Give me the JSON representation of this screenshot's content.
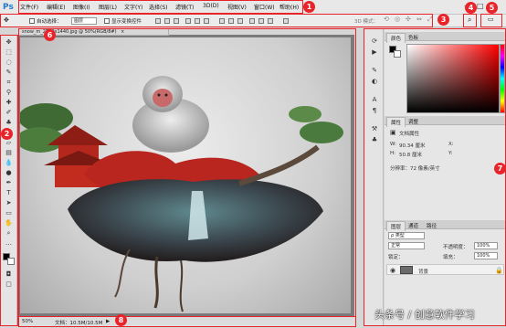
{
  "app": {
    "logo": "Ps"
  },
  "menubar": {
    "items": [
      "文件(F)",
      "编辑(E)",
      "图像(I)",
      "图层(L)",
      "文字(Y)",
      "选择(S)",
      "滤镜(T)",
      "3D(D)",
      "视图(V)",
      "窗口(W)",
      "帮助(H)"
    ],
    "window_controls": [
      "–",
      "□",
      "×"
    ]
  },
  "options_bar": {
    "auto_select_label": "自动选择：",
    "auto_select_value": "图层",
    "show_transform_label": "显示变换控件",
    "mode_3d_label": "3D 模式："
  },
  "document": {
    "tab_title": "snow_m_2560x1440.jpg @ 50%(RGB/8#)",
    "close_glyph": "×"
  },
  "status_bar": {
    "zoom": "50%",
    "doc_info": "文档：10.5M/10.5M",
    "arrow": "▶"
  },
  "panels": {
    "color_tabs": [
      "颜色",
      "色板"
    ],
    "properties_tabs": [
      "属性",
      "调整"
    ],
    "properties_title": "文档属性",
    "prop_w_label": "W:",
    "prop_w_value": "90.34 厘米",
    "prop_h_label": "H:",
    "prop_h_value": "50.8 厘米",
    "prop_x_label": "X:",
    "prop_y_label": "Y:",
    "prop_resolution": "分辨率：72 像素/英寸",
    "layers_tabs": [
      "图层",
      "通道",
      "路径"
    ],
    "layer_filter": "ρ 类型",
    "blend_mode": "正常",
    "opacity_label": "不透明度：",
    "opacity_value": "100%",
    "lock_label": "锁定：",
    "fill_label": "填充：",
    "fill_value": "100%",
    "layer_name": "背景"
  },
  "annotations": [
    "1",
    "2",
    "3",
    "4",
    "5",
    "6",
    "7",
    "8"
  ],
  "watermark": "头条号 / 创意软件学习",
  "colors": {
    "annotation_red": "#e8242a",
    "foreground": "#000000",
    "background": "#ffffff",
    "ps_blue": "#2478c8"
  }
}
